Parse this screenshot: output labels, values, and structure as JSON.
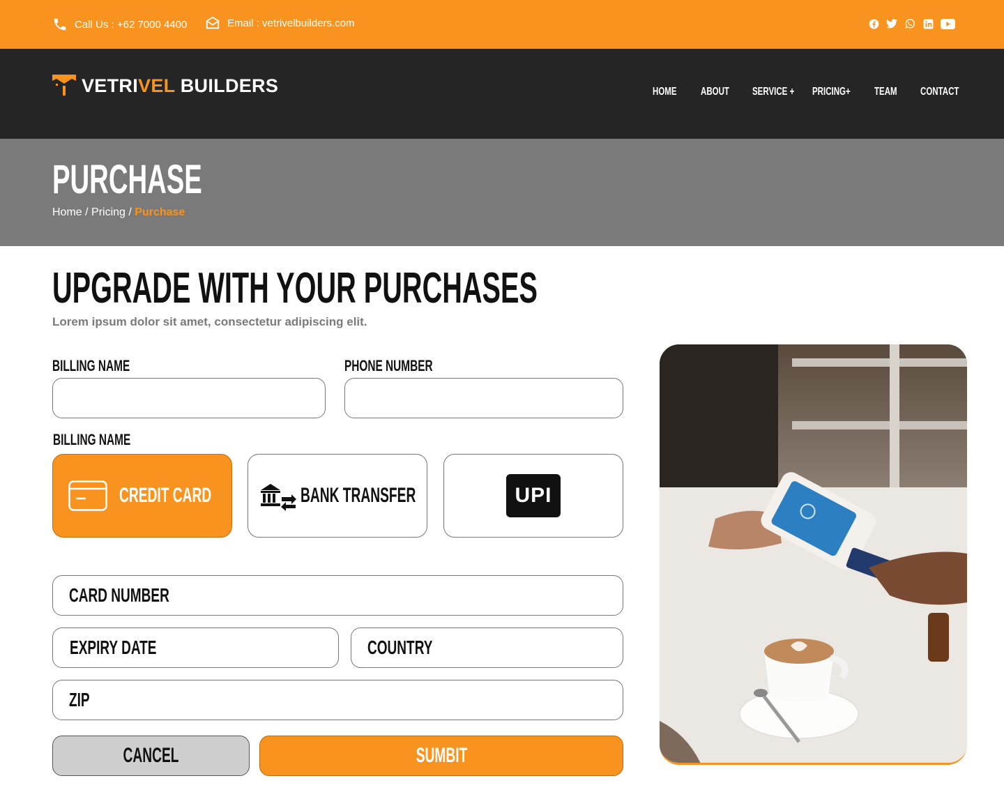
{
  "topbar": {
    "phone": "Call Us : +62 7000 4400",
    "email": "Email : vetrivelbuilders.com",
    "socials": [
      "facebook-icon",
      "twitter-icon",
      "whatsapp-icon",
      "linkedin-icon",
      "youtube-icon"
    ]
  },
  "header": {
    "logo_part1": "VETRI",
    "logo_part2": "VEL",
    "logo_part3": " BUILDERS",
    "nav": [
      "HOME",
      "ABOUT",
      "SERVICE +",
      "PRICING+",
      "TEAM",
      "CONTACT"
    ]
  },
  "banner": {
    "title": "PURCHASE",
    "crumb_home": "Home",
    "crumb_sep1": " / ",
    "crumb_pricing": "Pricing",
    "crumb_sep2": " / ",
    "crumb_current": "Purchase"
  },
  "form": {
    "title": "UPGRADE WITH YOUR PURCHASES",
    "subtitle": "Lorem ipsum dolor sit amet, consectetur adipiscing elit.",
    "billing_name_label": "BILLING NAME",
    "phone_label": "PHONE NUMBER",
    "payment_label": "BILLING NAME",
    "payment_options": {
      "credit_card": "CREDIT CARD",
      "bank_transfer": "BANK TRANSFER",
      "upi": "UPI"
    },
    "card_number": "CARD NUMBER",
    "expiry": "EXPIRY DATE",
    "country": "COUNTRY",
    "zip": "ZIP",
    "cancel": "CANCEL",
    "submit": "SUMBIT"
  },
  "colors": {
    "accent": "#f7931e",
    "header_bg": "#252525",
    "banner_bg": "#7a7a7a"
  }
}
